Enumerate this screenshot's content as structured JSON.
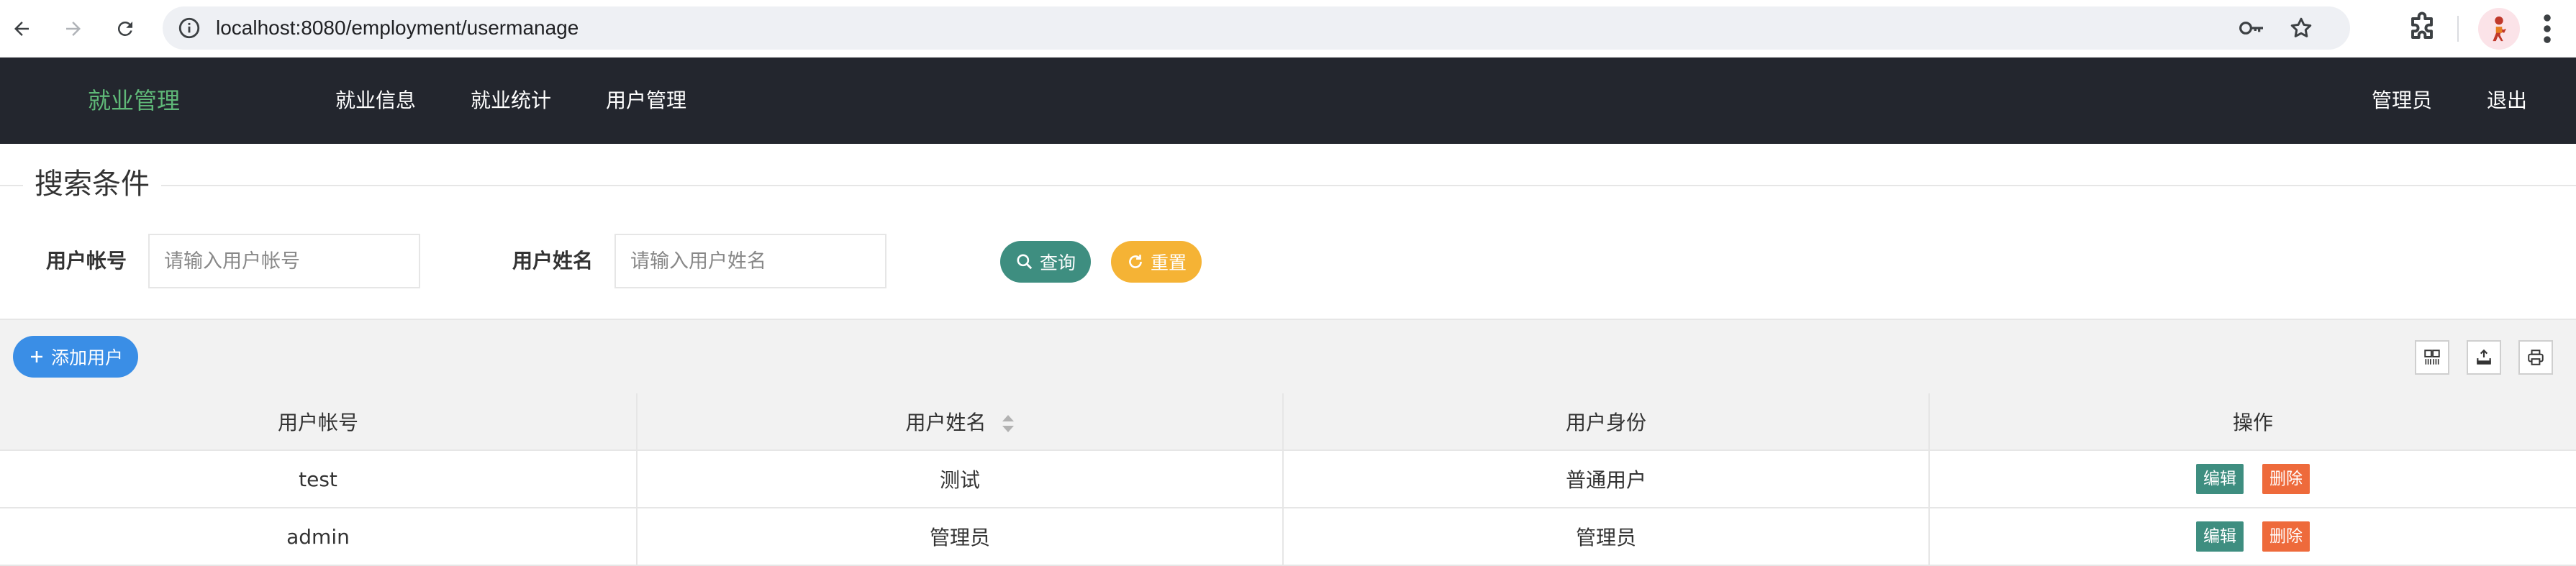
{
  "browser": {
    "url": "localhost:8080/employment/usermanage"
  },
  "header": {
    "logo": "就业管理",
    "nav": [
      "就业信息",
      "就业统计",
      "用户管理"
    ],
    "user": "管理员",
    "logout": "退出"
  },
  "search": {
    "legend": "搜索条件",
    "account_label": "用户帐号",
    "account_placeholder": "请输入用户帐号",
    "name_label": "用户姓名",
    "name_placeholder": "请输入用户姓名",
    "query_label": "查询",
    "reset_label": "重置"
  },
  "toolbar": {
    "add_label": "添加用户"
  },
  "table": {
    "columns": [
      "用户帐号",
      "用户姓名",
      "用户身份",
      "操作"
    ],
    "rows": [
      {
        "account": "test",
        "name": "测试",
        "role": "普通用户",
        "edit": "编辑",
        "delete": "删除"
      },
      {
        "account": "admin",
        "name": "管理员",
        "role": "管理员",
        "edit": "编辑",
        "delete": "删除"
      }
    ]
  },
  "colors": {
    "header_bg": "#23262e",
    "logo": "#5fb878",
    "query_button": "#3e8e80",
    "reset_button": "#f5b335",
    "add_button": "#3a8ee6",
    "delete_button": "#ee6a3b"
  }
}
